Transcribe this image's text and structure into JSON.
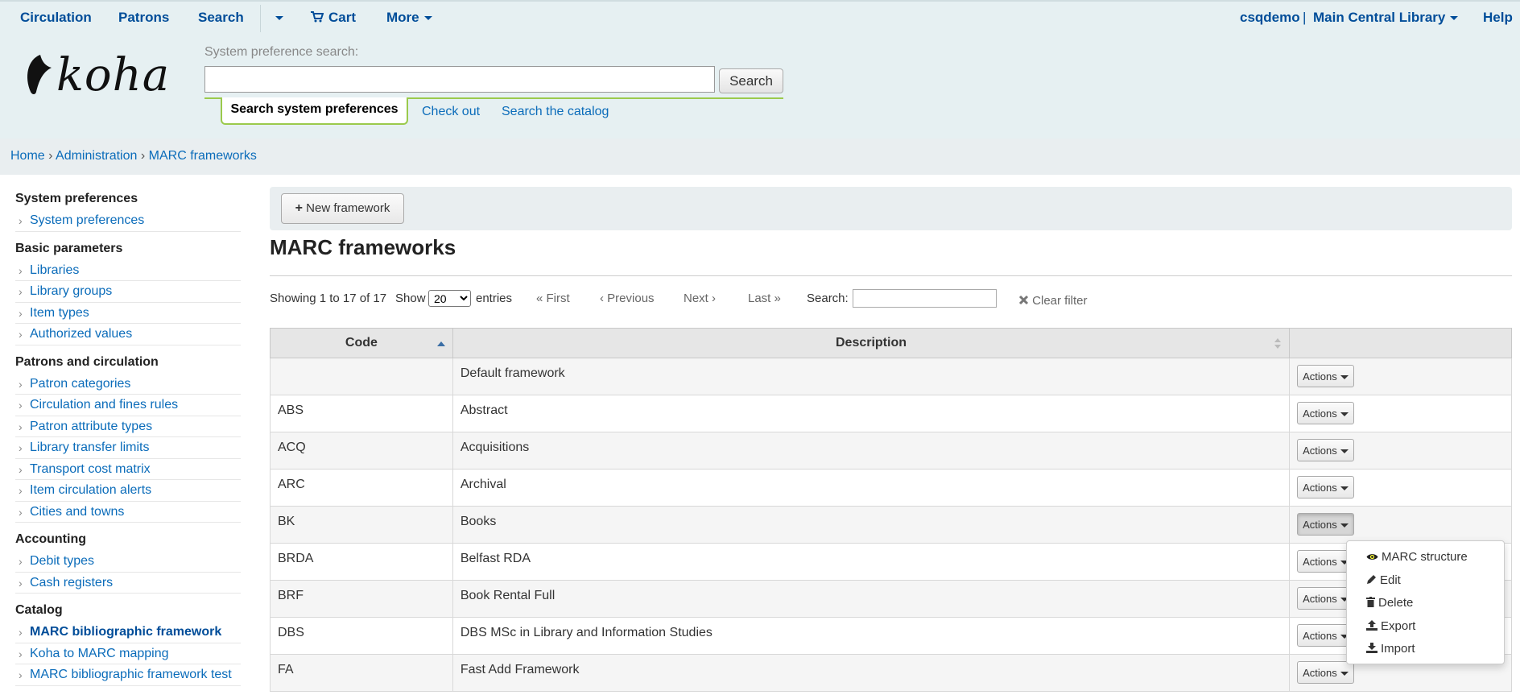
{
  "topnav": {
    "circulation": "Circulation",
    "patrons": "Patrons",
    "search": "Search",
    "cart": "Cart",
    "more": "More",
    "user": "csqdemo",
    "separator": "|",
    "library": "Main Central Library",
    "help": "Help"
  },
  "header": {
    "logo_text": "koha",
    "pref_label": "System preference search:",
    "pref_value": "",
    "search_button": "Search",
    "tabs": [
      "Search system preferences",
      "Check out",
      "Search the catalog"
    ]
  },
  "breadcrumb": {
    "home": "Home",
    "admin": "Administration",
    "current": "MARC frameworks",
    "sep": "›"
  },
  "sidebar": {
    "sections": [
      {
        "title": "System preferences",
        "items": [
          "System preferences"
        ]
      },
      {
        "title": "Basic parameters",
        "items": [
          "Libraries",
          "Library groups",
          "Item types",
          "Authorized values"
        ]
      },
      {
        "title": "Patrons and circulation",
        "items": [
          "Patron categories",
          "Circulation and fines rules",
          "Patron attribute types",
          "Library transfer limits",
          "Transport cost matrix",
          "Item circulation alerts",
          "Cities and towns"
        ]
      },
      {
        "title": "Accounting",
        "items": [
          "Debit types",
          "Cash registers"
        ]
      },
      {
        "title": "Catalog",
        "items": [
          "MARC bibliographic framework",
          "Koha to MARC mapping",
          "MARC bibliographic framework test"
        ]
      }
    ]
  },
  "toolbar": {
    "new_framework": "New framework"
  },
  "page": {
    "title": "MARC frameworks"
  },
  "datatable": {
    "info": "Showing 1 to 17 of 17",
    "show": "Show",
    "entries_value": "20",
    "entries": "entries",
    "first": "First",
    "previous": "Previous",
    "next": "Next",
    "last": "Last",
    "search_label": "Search:",
    "clear_filter": "Clear filter",
    "first_prefix": "«",
    "previous_prefix": "‹",
    "next_suffix": "›",
    "last_suffix": "»"
  },
  "table": {
    "headers": [
      "Code",
      "Description",
      ""
    ],
    "actions_label": "Actions",
    "rows": [
      {
        "code": "",
        "description": "Default framework"
      },
      {
        "code": "ABS",
        "description": "Abstract"
      },
      {
        "code": "ACQ",
        "description": "Acquisitions"
      },
      {
        "code": "ARC",
        "description": "Archival"
      },
      {
        "code": "BK",
        "description": "Books"
      },
      {
        "code": "BRDA",
        "description": "Belfast RDA"
      },
      {
        "code": "BRF",
        "description": "Book Rental Full"
      },
      {
        "code": "DBS",
        "description": "DBS MSc in Library and Information Studies"
      },
      {
        "code": "FA",
        "description": "Fast Add Framework"
      }
    ]
  },
  "dropdown": {
    "items": [
      "MARC structure",
      "Edit",
      "Delete",
      "Export",
      "Import"
    ],
    "highlight_color": "#ffff33"
  },
  "colors": {
    "link": "#0b6cba",
    "nav_link": "#004d99",
    "header_bg": "#e6f0f2",
    "tab_border": "#9bca4c"
  }
}
